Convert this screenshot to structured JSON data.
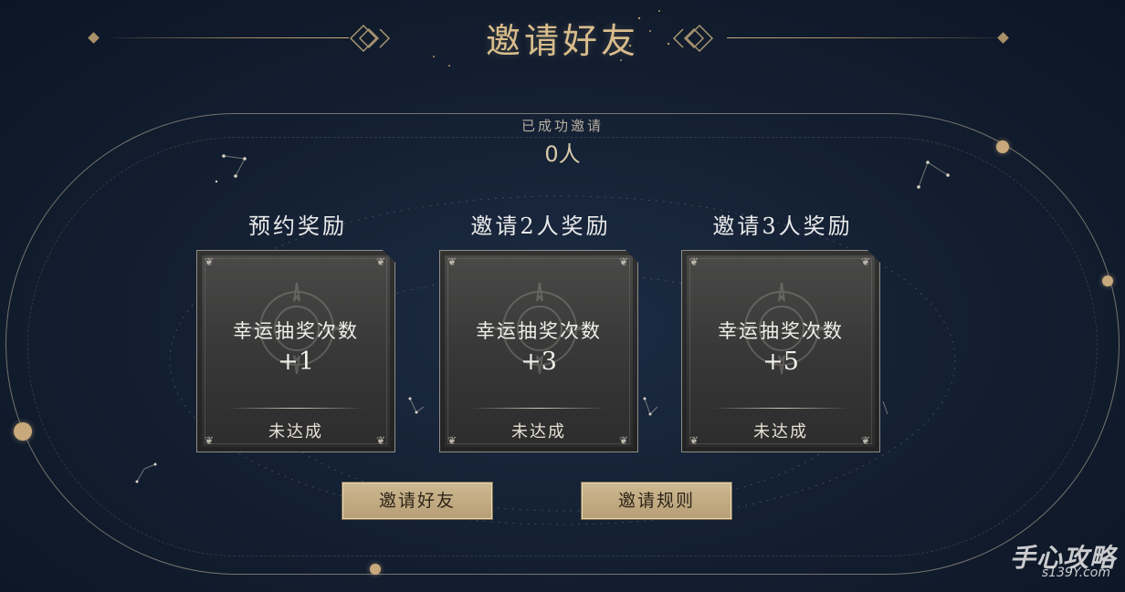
{
  "header": {
    "title": "邀请好友"
  },
  "counter": {
    "label": "已成功邀请",
    "value": "0人"
  },
  "rewards": [
    {
      "title": "预约奖励",
      "name": "幸运抽奖次数",
      "amount": "+1",
      "status": "未达成"
    },
    {
      "title": "邀请2人奖励",
      "name": "幸运抽奖次数",
      "amount": "+3",
      "status": "未达成"
    },
    {
      "title": "邀请3人奖励",
      "name": "幸运抽奖次数",
      "amount": "+5",
      "status": "未达成"
    }
  ],
  "buttons": {
    "invite": "邀请好友",
    "rules": "邀请规则"
  },
  "watermark": {
    "brand": "手心攻略",
    "site": "s139Y.com"
  },
  "colors": {
    "accent_gold": "#d9bd8c",
    "button_gold": "#c4ad85",
    "background": "#142033"
  }
}
